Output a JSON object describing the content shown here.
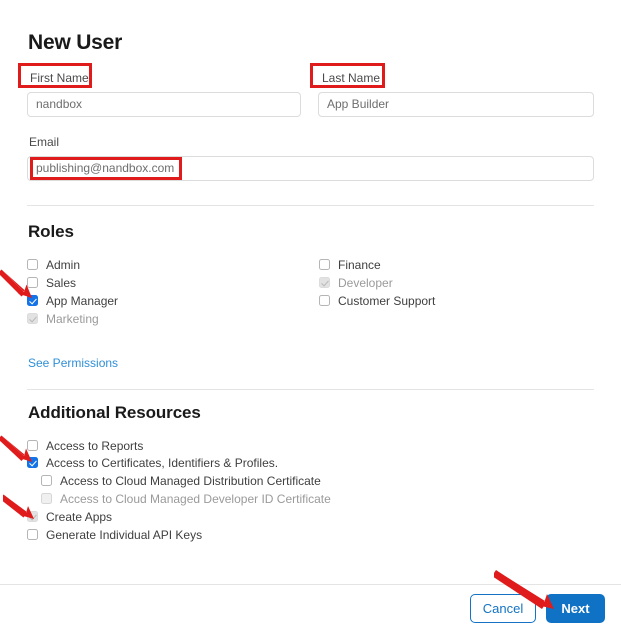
{
  "page": {
    "title": "New User"
  },
  "form": {
    "first_name": {
      "label": "First Name",
      "value": "nandbox"
    },
    "last_name": {
      "label": "Last Name",
      "value": "App Builder"
    },
    "email": {
      "label": "Email",
      "value": "publishing@nandbox.com"
    }
  },
  "roles": {
    "heading": "Roles",
    "left_items": [
      {
        "label": "Admin",
        "checked": false,
        "disabled": false
      },
      {
        "label": "Sales",
        "checked": false,
        "disabled": false
      },
      {
        "label": "App Manager",
        "checked": true,
        "disabled": false
      },
      {
        "label": "Marketing",
        "checked": true,
        "disabled": true
      }
    ],
    "right_items": [
      {
        "label": "Finance",
        "checked": false,
        "disabled": false
      },
      {
        "label": "Developer",
        "checked": true,
        "disabled": true
      },
      {
        "label": "Customer Support",
        "checked": false,
        "disabled": false
      }
    ],
    "see_permissions_link": "See Permissions"
  },
  "additional_resources": {
    "heading": "Additional Resources",
    "items": [
      {
        "label": "Access to Reports",
        "checked": false,
        "disabled": false,
        "indent": false
      },
      {
        "label": "Access to Certificates, Identifiers & Profiles.",
        "checked": true,
        "disabled": false,
        "indent": false
      },
      {
        "label": "Access to Cloud Managed Distribution Certificate",
        "checked": false,
        "disabled": false,
        "indent": true
      },
      {
        "label": "Access to Cloud Managed Developer ID Certificate",
        "checked": false,
        "disabled": true,
        "indent": true
      },
      {
        "label": "Create Apps",
        "checked": true,
        "disabled": true,
        "indent": false
      },
      {
        "label": "Generate Individual API Keys",
        "checked": false,
        "disabled": false,
        "indent": false
      }
    ]
  },
  "footer": {
    "cancel_label": "Cancel",
    "next_label": "Next"
  },
  "annotations": {
    "accent_color": "#e01b1b",
    "highlight_boxes": [
      {
        "target": "first-name-label"
      },
      {
        "target": "last-name-label"
      },
      {
        "target": "email-value"
      }
    ],
    "arrows": [
      {
        "target": "app-manager-checkbox"
      },
      {
        "target": "access-certificates-checkbox"
      },
      {
        "target": "create-apps-checkbox"
      },
      {
        "target": "next-button"
      }
    ]
  }
}
